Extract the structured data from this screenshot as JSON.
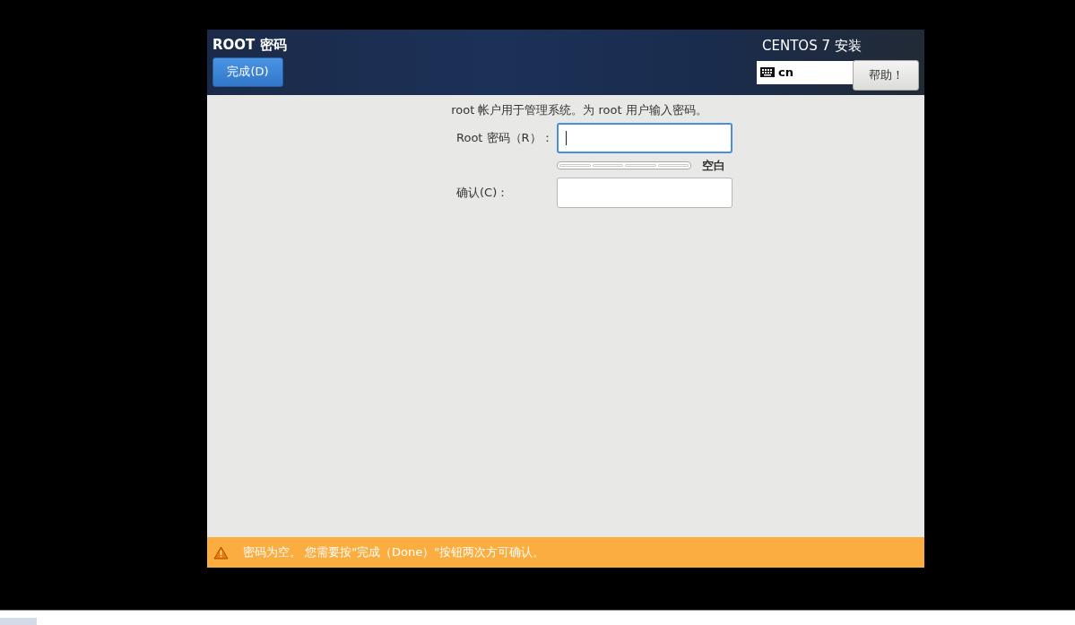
{
  "header": {
    "title": "ROOT 密码",
    "done_button": "完成(D)",
    "product": "CENTOS 7 安装",
    "keyboard_layout": "cn",
    "help_button": "帮助！"
  },
  "form": {
    "intro": "root 帐户用于管理系统。为 root 用户输入密码。",
    "fields": [
      {
        "label": "Root 密码（R）：",
        "focused": true
      },
      {
        "label": "确认(C)：",
        "focused": false
      }
    ],
    "strength": {
      "label": "空白"
    }
  },
  "warning": {
    "text": "密码为空。 您需要按\"完成（Done）\"按钮两次方可确认。"
  }
}
